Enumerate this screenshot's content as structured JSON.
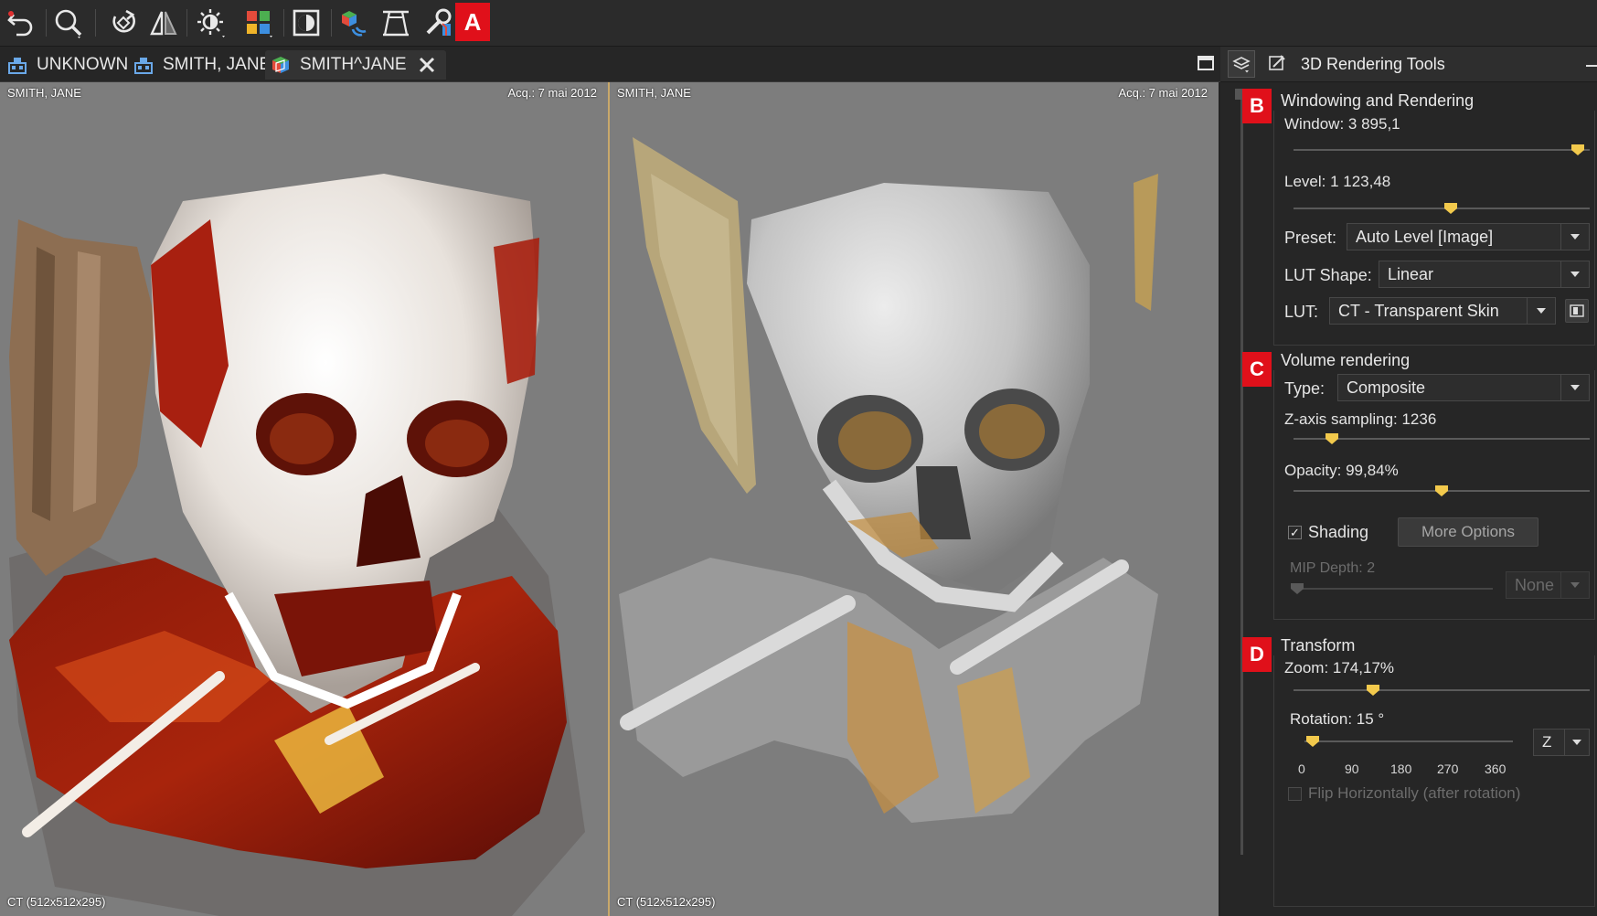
{
  "toolbar": {
    "icons": [
      "undo-icon",
      "zoom-icon",
      "rotate-icon",
      "flip-icon",
      "brightness-icon",
      "layout-grid-icon",
      "invert-icon",
      "sync-3d-icon",
      "reslice-icon",
      "settings-tools-icon"
    ],
    "badge_a": "A"
  },
  "tabs": [
    {
      "label": "UNKNOWN"
    },
    {
      "label": "SMITH, JANE"
    },
    {
      "label": "SMITH^JANE",
      "active": true
    }
  ],
  "viewports": [
    {
      "patient": "SMITH, JANE",
      "acq": "Acq.: 7 mai 2012",
      "series": "CT (512x512x295)",
      "style": "transparent-skin"
    },
    {
      "patient": "SMITH, JANE",
      "acq": "Acq.: 7 mai 2012",
      "series": "CT (512x512x295)",
      "style": "bone"
    }
  ],
  "panel": {
    "title": "3D Rendering Tools",
    "badges": {
      "b": "B",
      "c": "C",
      "d": "D"
    },
    "windowing": {
      "title": "Windowing and Rendering",
      "window_label": "Window: 3 895,1",
      "window_level": 0.96,
      "level_label": "Level: 1 123,48",
      "level_level": 0.53,
      "preset_label": "Preset:",
      "preset_value": "Auto Level [Image]",
      "lut_shape_label": "LUT Shape:",
      "lut_shape_value": "Linear",
      "lut_label": "LUT:",
      "lut_value": "CT - Transparent Skin"
    },
    "volume": {
      "title": "Volume rendering",
      "type_label": "Type:",
      "type_value": "Composite",
      "zaxis_label": "Z-axis sampling: 1236",
      "zaxis_level": 0.13,
      "opacity_label": "Opacity: 99,84%",
      "opacity_level": 0.5,
      "shading_label": "Shading",
      "shading_checked": true,
      "more_options": "More Options",
      "mip_label": "MIP Depth: 2",
      "mip_level": 0.02,
      "mip_mode": "None"
    },
    "transform": {
      "title": "Transform",
      "zoom_label": "Zoom: 174,17%",
      "zoom_level": 0.27,
      "rotation_label": "Rotation: 15 °",
      "rotation_deg": 15,
      "axis_value": "Z",
      "ticks": [
        "0",
        "90",
        "180",
        "270",
        "360"
      ],
      "flip_label": "Flip Horizontally (after rotation)"
    }
  },
  "colors": {
    "accent": "#f2c94c",
    "badge": "#e0101a",
    "viewport_bg": "#7d7d7d",
    "panel_bg": "#262626"
  }
}
